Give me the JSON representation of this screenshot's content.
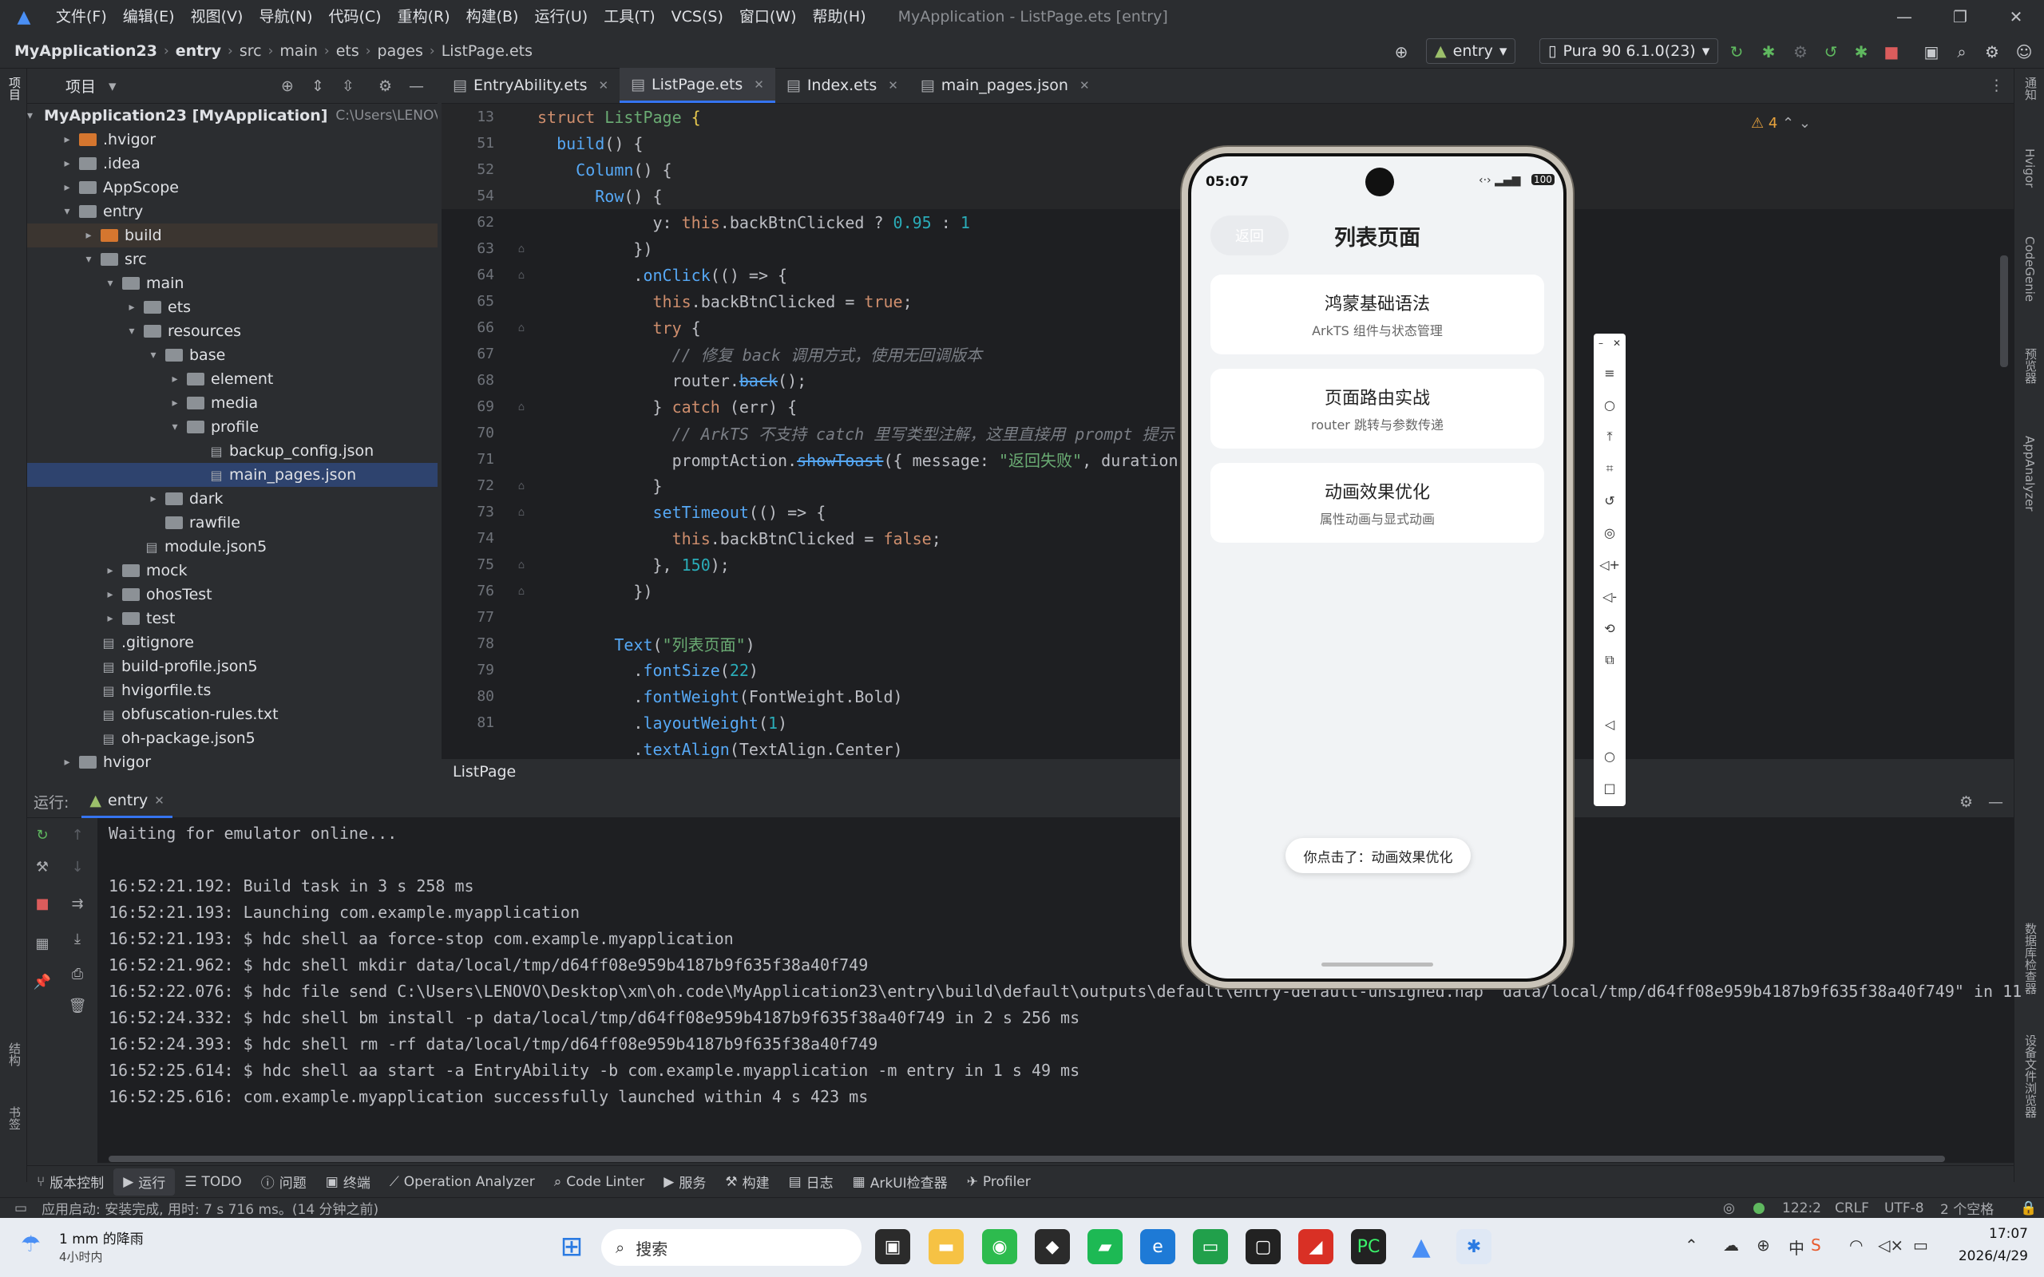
{
  "menubar": {
    "items": [
      "文件(F)",
      "编辑(E)",
      "视图(V)",
      "导航(N)",
      "代码(C)",
      "重构(R)",
      "构建(B)",
      "运行(U)",
      "工具(T)",
      "VCS(S)",
      "窗口(W)",
      "帮助(H)"
    ],
    "window_title": "MyApplication - ListPage.ets [entry]"
  },
  "navbar": {
    "crumbs": [
      "MyApplication23",
      "entry",
      "src",
      "main",
      "ets",
      "pages",
      "ListPage.ets"
    ],
    "run_config": "entry",
    "device": "Pura 90 6.1.0(23)"
  },
  "project": {
    "title": "项目",
    "tree": [
      {
        "label": "MyApplication23 [MyApplication]",
        "hint": "C:\\Users\\LENOVO",
        "indent": 0,
        "arrow": "▾",
        "kind": "folder"
      },
      {
        "label": ".hvigor",
        "indent": 1,
        "arrow": "▸",
        "kind": "orange"
      },
      {
        "label": ".idea",
        "indent": 1,
        "arrow": "▸",
        "kind": "folder"
      },
      {
        "label": "AppScope",
        "indent": 1,
        "arrow": "▸",
        "kind": "folder"
      },
      {
        "label": "entry",
        "indent": 1,
        "arrow": "▾",
        "kind": "folder"
      },
      {
        "label": "build",
        "indent": 2,
        "arrow": "▸",
        "kind": "orange"
      },
      {
        "label": "src",
        "indent": 2,
        "arrow": "▾",
        "kind": "folder"
      },
      {
        "label": "main",
        "indent": 3,
        "arrow": "▾",
        "kind": "folder"
      },
      {
        "label": "ets",
        "indent": 4,
        "arrow": "▸",
        "kind": "folder"
      },
      {
        "label": "resources",
        "indent": 4,
        "arrow": "▾",
        "kind": "folder"
      },
      {
        "label": "base",
        "indent": 5,
        "arrow": "▾",
        "kind": "folder"
      },
      {
        "label": "element",
        "indent": 6,
        "arrow": "▸",
        "kind": "folder"
      },
      {
        "label": "media",
        "indent": 6,
        "arrow": "▸",
        "kind": "folder"
      },
      {
        "label": "profile",
        "indent": 6,
        "arrow": "▾",
        "kind": "folder"
      },
      {
        "label": "backup_config.json",
        "indent": 7,
        "arrow": "",
        "kind": "file"
      },
      {
        "label": "main_pages.json",
        "indent": 7,
        "arrow": "",
        "kind": "file"
      },
      {
        "label": "dark",
        "indent": 5,
        "arrow": "▸",
        "kind": "folder"
      },
      {
        "label": "rawfile",
        "indent": 5,
        "arrow": "",
        "kind": "folder"
      },
      {
        "label": "module.json5",
        "indent": 4,
        "arrow": "",
        "kind": "file"
      },
      {
        "label": "mock",
        "indent": 3,
        "arrow": "▸",
        "kind": "folder"
      },
      {
        "label": "ohosTest",
        "indent": 3,
        "arrow": "▸",
        "kind": "folder"
      },
      {
        "label": "test",
        "indent": 3,
        "arrow": "▸",
        "kind": "folder"
      },
      {
        "label": ".gitignore",
        "indent": 2,
        "arrow": "",
        "kind": "file"
      },
      {
        "label": "build-profile.json5",
        "indent": 2,
        "arrow": "",
        "kind": "file"
      },
      {
        "label": "hvigorfile.ts",
        "indent": 2,
        "arrow": "",
        "kind": "file"
      },
      {
        "label": "obfuscation-rules.txt",
        "indent": 2,
        "arrow": "",
        "kind": "file"
      },
      {
        "label": "oh-package.json5",
        "indent": 2,
        "arrow": "",
        "kind": "file"
      },
      {
        "label": "hvigor",
        "indent": 1,
        "arrow": "▸",
        "kind": "folder"
      }
    ]
  },
  "editor": {
    "tabs": [
      "EntryAbility.ets",
      "ListPage.ets",
      "Index.ets",
      "main_pages.json"
    ],
    "active_tab": 1,
    "warnings": "4",
    "breadcrumb": "ListPage",
    "line_numbers": [
      "13",
      "51",
      "52",
      "54",
      "62",
      "63",
      "64",
      "65",
      "66",
      "67",
      "68",
      "69",
      "70",
      "71",
      "72",
      "73",
      "74",
      "75",
      "76",
      "77",
      "78",
      "79",
      "80",
      "81"
    ]
  },
  "run": {
    "label": "运行:",
    "config": "entry",
    "log": [
      "Waiting for emulator online...",
      "",
      "16:52:21.192: Build task in 3 s 258 ms",
      "16:52:21.193: Launching com.example.myapplication",
      "16:52:21.193: $ hdc shell aa force-stop com.example.myapplication",
      "16:52:21.962: $ hdc shell mkdir data/local/tmp/d64ff08e959b4187b9f635f38a40f749",
      "16:52:22.076: $ hdc file send C:\\Users\\LENOVO\\Desktop\\xm\\oh.code\\MyApplication23\\entry\\build\\default\\outputs\\default\\entry-default-unsigned.hap \"data/local/tmp/d64ff08e959b4187b9f635f38a40f749\" in 11",
      "16:52:24.332: $ hdc shell bm install -p data/local/tmp/d64ff08e959b4187b9f635f38a40f749 in 2 s 256 ms",
      "16:52:24.393: $ hdc shell rm -rf data/local/tmp/d64ff08e959b4187b9f635f38a40f749",
      "16:52:25.614: $ hdc shell aa start -a EntryAbility -b com.example.myapplication -m entry in 1 s 49 ms",
      "16:52:25.616: com.example.myapplication successfully launched within 4 s 423 ms"
    ]
  },
  "tool_tabs": [
    "版本控制",
    "运行",
    "TODO",
    "问题",
    "终端",
    "Operation Analyzer",
    "Code Linter",
    "服务",
    "构建",
    "日志",
    "ArkUI检查器",
    "Profiler"
  ],
  "status": {
    "message": "应用启动: 安装完成, 用时: 7 s 716 ms。(14 分钟之前)",
    "position": "122:2",
    "line_sep": "CRLF",
    "encoding": "UTF-8",
    "indent": "2 个空格"
  },
  "taskbar": {
    "weather_title": "1 mm 的降雨",
    "weather_sub": "4小时内",
    "search": "搜索",
    "time": "17:07",
    "date": "2026/4/29"
  },
  "phone": {
    "time": "05:07",
    "battery": "100",
    "back": "返回",
    "title": "列表页面",
    "cards": [
      {
        "title": "鸿蒙基础语法",
        "subtitle": "ArkTS 组件与状态管理"
      },
      {
        "title": "页面路由实战",
        "subtitle": "router 跳转与参数传递"
      },
      {
        "title": "动画效果优化",
        "subtitle": "属性动画与显式动画"
      }
    ],
    "toast": "你点击了：动画效果优化"
  },
  "side_labels": {
    "left": [
      "项目",
      "结构",
      "书签"
    ],
    "right": [
      "通知",
      "Hvigor",
      "CodeGenie",
      "预览器",
      "AppAnalyzer",
      "数据库检查器",
      "设备文件浏览器"
    ]
  }
}
